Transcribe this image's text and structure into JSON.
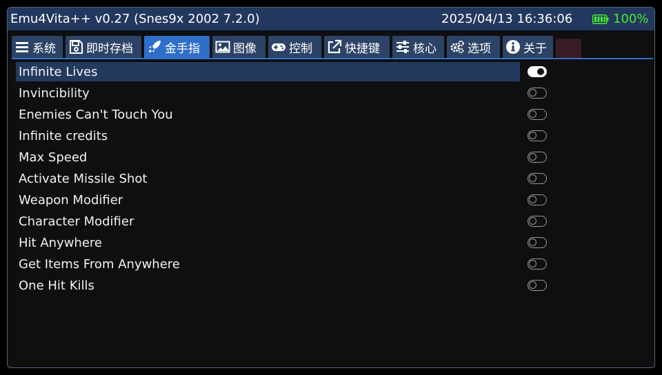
{
  "header": {
    "title": "Emu4Vita++ v0.27 (Snes9x 2002 7.2.0)",
    "datetime": "2025/04/13 16:36:06",
    "battery_percent": "100%",
    "battery_icon": "battery-full-icon"
  },
  "tabs": [
    {
      "label": "系统",
      "icon": "menu-icon",
      "active": false
    },
    {
      "label": "即时存档",
      "icon": "save-icon",
      "active": false
    },
    {
      "label": "金手指",
      "icon": "rocket-icon",
      "active": true
    },
    {
      "label": "图像",
      "icon": "image-icon",
      "active": false
    },
    {
      "label": "控制",
      "icon": "gamepad-icon",
      "active": false
    },
    {
      "label": "快捷键",
      "icon": "external-link-icon",
      "active": false
    },
    {
      "label": "核心",
      "icon": "sliders-icon",
      "active": false
    },
    {
      "label": "选项",
      "icon": "gears-icon",
      "active": false
    },
    {
      "label": "关于",
      "icon": "info-icon",
      "active": false
    }
  ],
  "cheats": [
    {
      "label": "Infinite Lives",
      "enabled": true,
      "selected": true
    },
    {
      "label": "Invincibility",
      "enabled": false,
      "selected": false
    },
    {
      "label": "Enemies Can't Touch You",
      "enabled": false,
      "selected": false
    },
    {
      "label": "Infinite credits",
      "enabled": false,
      "selected": false
    },
    {
      "label": "Max Speed",
      "enabled": false,
      "selected": false
    },
    {
      "label": "Activate Missile Shot",
      "enabled": false,
      "selected": false
    },
    {
      "label": "Weapon Modifier",
      "enabled": false,
      "selected": false
    },
    {
      "label": "Character Modifier",
      "enabled": false,
      "selected": false
    },
    {
      "label": "Hit Anywhere",
      "enabled": false,
      "selected": false
    },
    {
      "label": "Get Items From Anywhere",
      "enabled": false,
      "selected": false
    },
    {
      "label": "One Hit Kills",
      "enabled": false,
      "selected": false
    }
  ],
  "colors": {
    "titlebar": "#22385e",
    "tab": "#2d4366",
    "tab_active": "#2f6fc9",
    "battery": "#49ed2c",
    "selection": "#223a5e"
  }
}
